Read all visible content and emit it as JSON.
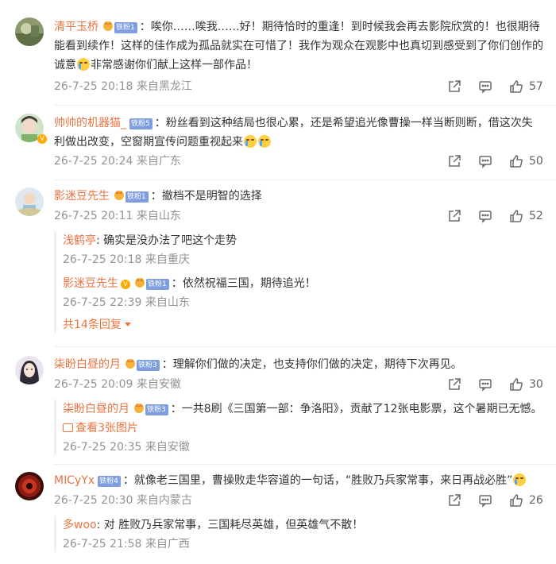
{
  "comments": [
    {
      "user": "清平玉桥",
      "fan_badge": "铁粉1",
      "colon": "：",
      "text": "唉你……唉我……好！期待恰时的重逢！到时候我会再去影院欣赏的！也很期待能看到续作！这样的佳作成为孤品就实在可惜了！我作为观众在观影中也真切到感受到了你们创作的诚意",
      "text_tail": "非常感谢你们献上这样一部作品！",
      "time": "26-7-25 20:18",
      "location": "来自黑龙江",
      "likes": "57"
    },
    {
      "user": "帅帅的机器猫_",
      "fan_badge": "铁粉5",
      "colon": "：",
      "text": "粉丝看到这种结局也很心累，还是希望追光像曹操一样当断则断，借这次失利做出改变，空窗期宣传问题重视起来",
      "time": "26-7-25 20:24",
      "location": "来自广东",
      "likes": "50"
    },
    {
      "user": "影迷豆先生",
      "fan_badge": "铁粉1",
      "colon": "：",
      "text": "撤档不是明智的选择",
      "time": "26-7-25 20:11",
      "location": "来自山东",
      "likes": "52",
      "replies": [
        {
          "user": "浅鹤亭",
          "colon": ": ",
          "text": "确实是没办法了吧这个走势",
          "time": "26-7-25 20:18",
          "location": "来自重庆"
        },
        {
          "user": "影迷豆先生",
          "fan_badge": "铁粉1",
          "colon": "：",
          "text": "依然祝福三国，期待追光！",
          "time": "26-7-25 22:39",
          "location": "来自山东"
        }
      ],
      "more_replies": "共14条回复"
    },
    {
      "user": "柒盼白昼的月",
      "fan_badge": "铁粉3",
      "colon": "：",
      "text": "理解你们做的决定，也支持你们做的决定，期待下次再见。",
      "time": "26-7-25 20:09",
      "location": "来自安徽",
      "likes": "30",
      "replies": [
        {
          "user": "柒盼白昼的月",
          "fan_badge": "铁粉3",
          "colon": "：",
          "text": "一共8刷《三国第一部：争洛阳》，贡献了12张电影票，这个暑期已无憾。",
          "pic_link": "查看3张图片",
          "time": "26-7-25 20:35",
          "location": "来自安徽"
        }
      ]
    },
    {
      "user": "MICyYx",
      "fan_badge": "铁粉4",
      "colon": "：",
      "text": "就像老三国里，曹操败走华容道的一句话，“胜败乃兵家常事，来日再战必胜”",
      "time": "26-7-25 20:30",
      "location": "来自内蒙古",
      "likes": "26",
      "replies": [
        {
          "user": "多woo",
          "colon": ": ",
          "text": "对 胜败乃兵家常事，三国耗尽英雄，但英雄气不散！",
          "time": "26-7-25 21:58",
          "location": "来自广西"
        }
      ]
    }
  ],
  "icons": {
    "share": "share-icon",
    "comment": "comment-icon",
    "like": "thumbs-up-icon",
    "emoji": "crying-emoji-icon"
  },
  "colors": {
    "username": "#eb7340",
    "meta": "#939393",
    "badge": "#7e9ee0"
  }
}
